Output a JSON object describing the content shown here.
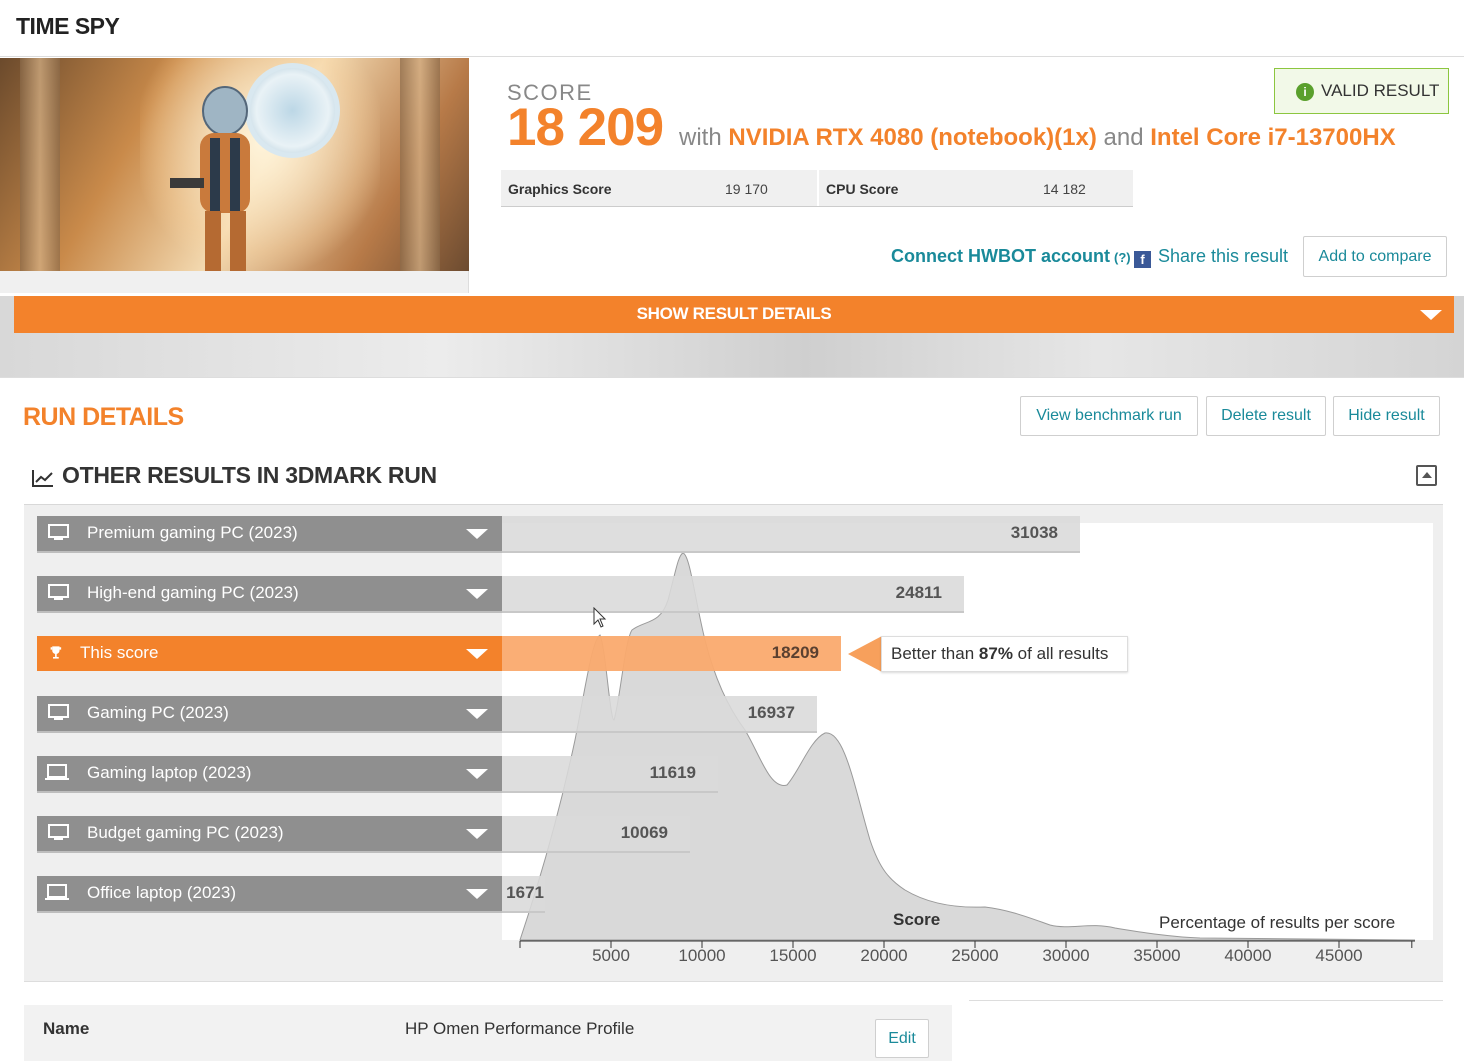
{
  "header": {
    "title": "TIME SPY"
  },
  "result": {
    "score_label": "SCORE",
    "score_value": "18 209",
    "with_text": "with",
    "gpu": "NVIDIA RTX 4080 (notebook)(1x)",
    "and_text": "and",
    "cpu": "Intel Core i7-13700HX",
    "valid_label": "VALID RESULT",
    "graphics_score_label": "Graphics Score",
    "graphics_score_value": "19 170",
    "cpu_score_label": "CPU Score",
    "cpu_score_value": "14 182"
  },
  "actions": {
    "hwbot_label": "Connect HWBOT account",
    "hwbot_help": "(?)",
    "share_label": "Share this result",
    "compare_label": "Add to compare",
    "show_details_label": "SHOW RESULT DETAILS"
  },
  "run_details": {
    "title": "RUN DETAILS",
    "view_label": "View benchmark run",
    "delete_label": "Delete result",
    "hide_label": "Hide result"
  },
  "other_results": {
    "title": "OTHER RESULTS IN 3DMARK RUN",
    "rows": [
      {
        "label": "Premium gaming PC (2023)",
        "value": "31038",
        "icon": "desktop-icon"
      },
      {
        "label": "High-end gaming PC (2023)",
        "value": "24811",
        "icon": "desktop-icon"
      },
      {
        "label": "This score",
        "value": "18209",
        "icon": "trophy-icon"
      },
      {
        "label": "Gaming PC (2023)",
        "value": "16937",
        "icon": "desktop-icon"
      },
      {
        "label": "Gaming laptop (2023)",
        "value": "11619",
        "icon": "laptop-icon"
      },
      {
        "label": "Budget gaming PC (2023)",
        "value": "10069",
        "icon": "desktop-icon"
      },
      {
        "label": "Office laptop (2023)",
        "value": "1671",
        "icon": "laptop-icon"
      }
    ],
    "better_prefix": "Better than",
    "better_pct": "87%",
    "better_suffix": "of all results"
  },
  "chart_data": {
    "type": "area",
    "xlabel": "Score",
    "ylabel": "Percentage of results per score",
    "xlim": [
      0,
      49000
    ],
    "ticks": [
      "5000",
      "10000",
      "15000",
      "20000",
      "25000",
      "30000",
      "35000",
      "40000",
      "45000"
    ],
    "colors": {
      "accent": "#f3822b",
      "bars": "#dadada",
      "labels": "#8f8f8f"
    }
  },
  "profile": {
    "name_label": "Name",
    "name_value": "HP Omen Performance Profile",
    "edit_label": "Edit"
  }
}
